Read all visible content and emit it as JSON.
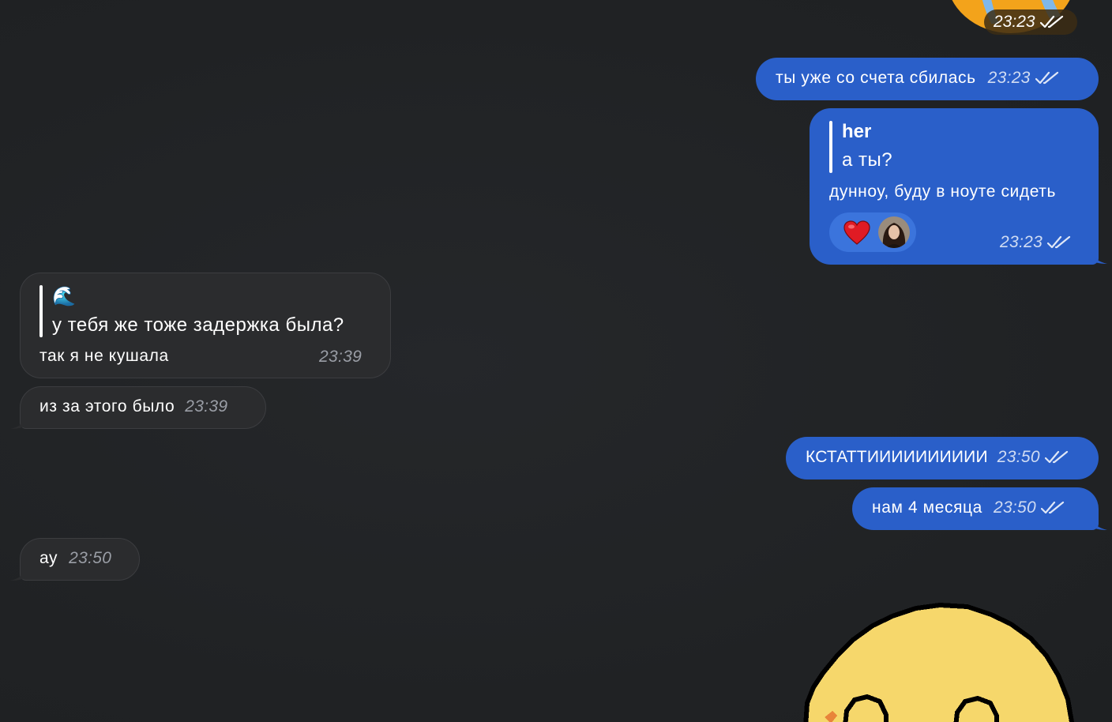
{
  "messages": [
    {
      "id": "m1",
      "text": "ты уже со счета сбилась",
      "time": "23:23",
      "direction": "out"
    },
    {
      "id": "m2",
      "quote_author": "her",
      "quote_text": "а ты?",
      "text": "дунноу, буду в ноуте сидеть",
      "time": "23:23",
      "direction": "out",
      "reactions": [
        {
          "icon": "red-heart-icon"
        },
        {
          "icon": "user-avatar"
        }
      ]
    },
    {
      "id": "m3",
      "quote_author": "🌊",
      "quote_text": "у тебя же тоже задержка была?",
      "text": "так я не кушала",
      "time": "23:39",
      "direction": "in"
    },
    {
      "id": "m4",
      "text": "из за этого было",
      "time": "23:39",
      "direction": "in"
    },
    {
      "id": "m5",
      "text": "КСТАТТИИИИИИИИИИ",
      "time": "23:50",
      "direction": "out"
    },
    {
      "id": "m6",
      "text": "нам 4 месяца",
      "time": "23:50",
      "direction": "out"
    },
    {
      "id": "m7",
      "text": "ау",
      "time": "23:50",
      "direction": "in"
    }
  ],
  "sticker_top": {
    "time": "23:23",
    "icon": "emoji-sticker"
  },
  "sticker_bottom": {
    "icon": "smiling-face-sticker"
  },
  "colors": {
    "outgoing": "#2a5fc9",
    "incoming": "#2b2c2e",
    "background": "#212325"
  }
}
